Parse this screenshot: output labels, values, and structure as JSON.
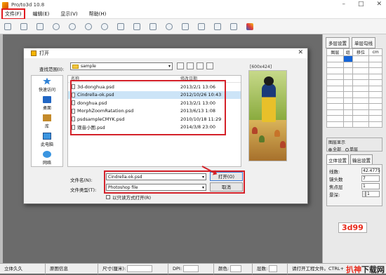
{
  "app": {
    "title": "Pro/to3d 10.8"
  },
  "menu": [
    "文件(F)",
    "编辑(E)",
    "显示(V)",
    "帮助(H)"
  ],
  "dialog": {
    "title": "打开",
    "lookin_label": "查找范围(I):",
    "lookin_value": "sample",
    "preview_size": "[600x424]",
    "places": [
      "快速访问",
      "桌面",
      "库",
      "此电脑",
      "网络"
    ],
    "columns": {
      "name": "名称",
      "date": "修改日期"
    },
    "files": [
      {
        "name": "3d-donghua.psd",
        "date": "2013/2/1 13:06"
      },
      {
        "name": "Cindrella-ok.psd",
        "date": "2012/10/26 10:43"
      },
      {
        "name": "donghua.psd",
        "date": "2013/2/1 13:00"
      },
      {
        "name": "MorphZoomRatation.psd",
        "date": "2013/6/13 1:08"
      },
      {
        "name": "psdsampleCMYK.psd",
        "date": "2010/10/18 11:29"
      },
      {
        "name": "观音小图.psd",
        "date": "2014/3/8 23:00"
      }
    ],
    "filename_label": "文件名(N):",
    "filename_value": "Cindrella-ok.psd",
    "filetype_label": "文件类型(T):",
    "filetype_value": "Photoshop file",
    "readonly_label": "以只读方式打开(R)",
    "open_button": "打开(O)",
    "cancel_button": "取消"
  },
  "right_panel": {
    "tabs": [
      "多层设置",
      "单层勾线"
    ],
    "grid_headers": [
      "图层",
      "组",
      "移位",
      "cm"
    ],
    "layer_display_title": "图层显示",
    "layer_options": [
      "全部",
      "单层"
    ],
    "tabs2": [
      "立体设置",
      "输出设置"
    ],
    "params": [
      {
        "label": "线数:",
        "value": "42.4775"
      },
      {
        "label": "镜头数",
        "value": "7"
      },
      {
        "label": "焦点层",
        "value": "1"
      },
      {
        "label": "景深:",
        "value": "1"
      }
    ],
    "brand": "3d99"
  },
  "status": {
    "items": [
      "立体久久",
      "原图信息",
      "尺寸(厘米):",
      "DPI:",
      "颜色:",
      "层数:",
      "请打开工程文件。CTRL+"
    ],
    "watermark_a": "扒神",
    "watermark_b": "下载网"
  },
  "colors": {
    "highlight": "#d42129",
    "selection": "#cce4f7",
    "accent": "#1565d8"
  }
}
